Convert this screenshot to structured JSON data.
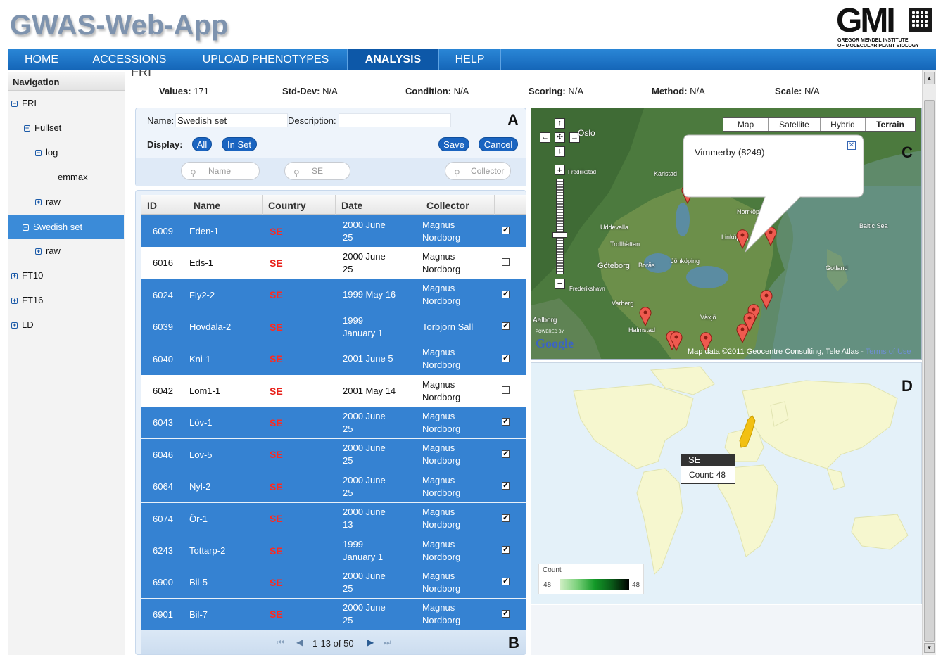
{
  "app": {
    "title": "GWAS-Web-App",
    "logo_text": "GMI",
    "logo_line1": "GREGOR MENDEL INSTITUTE",
    "logo_line2": "OF MOLECULAR PLANT BIOLOGY"
  },
  "nav": [
    "HOME",
    "ACCESSIONS",
    "UPLOAD PHENOTYPES",
    "ANALYSIS",
    "HELP"
  ],
  "sidebar": {
    "heading": "Navigation",
    "items": [
      "FRI",
      "Fullset",
      "log",
      "emmax",
      "raw",
      "Swedish set",
      "raw",
      "FT10",
      "FT16",
      "LD"
    ]
  },
  "page": {
    "heading": "FRI"
  },
  "stats": {
    "values_label": "Values:",
    "values": "171",
    "std_label": "Std-Dev:",
    "std": "N/A",
    "cond_label": "Condition:",
    "cond": "N/A",
    "scoring_label": "Scoring:",
    "scoring": "N/A",
    "method_label": "Method:",
    "method": "N/A",
    "scale_label": "Scale:",
    "scale": "N/A"
  },
  "setform": {
    "name_label": "Name:",
    "name_value": "Swedish set",
    "desc_label": "Description:",
    "desc_value": "",
    "display_label": "Display:",
    "all": "All",
    "inset": "In Set",
    "save": "Save",
    "cancel": "Cancel",
    "filter_name": "Name",
    "filter_country": "SE",
    "filter_collector": "Collector",
    "letter": "A"
  },
  "table": {
    "columns": [
      "ID",
      "Name",
      "Country",
      "Date",
      "Collector"
    ],
    "rows": [
      {
        "id": "6009",
        "name": "Eden-1",
        "country": "SE",
        "date1": "2000 June",
        "date2": "25",
        "col1": "Magnus",
        "col2": "Nordborg",
        "checked": true
      },
      {
        "id": "6016",
        "name": "Eds-1",
        "country": "SE",
        "date1": "2000 June",
        "date2": "25",
        "col1": "Magnus",
        "col2": "Nordborg",
        "checked": false
      },
      {
        "id": "6024",
        "name": "Fly2-2",
        "country": "SE",
        "date1": "1999 May 16",
        "date2": "",
        "col1": "Magnus",
        "col2": "Nordborg",
        "checked": true
      },
      {
        "id": "6039",
        "name": "Hovdala-2",
        "country": "SE",
        "date1": "1999",
        "date2": "January 1",
        "col1": "Torbjorn Sall",
        "col2": "",
        "checked": true
      },
      {
        "id": "6040",
        "name": "Kni-1",
        "country": "SE",
        "date1": "2001 June 5",
        "date2": "",
        "col1": "Magnus",
        "col2": "Nordborg",
        "checked": true
      },
      {
        "id": "6042",
        "name": "Lom1-1",
        "country": "SE",
        "date1": "2001 May 14",
        "date2": "",
        "col1": "Magnus",
        "col2": "Nordborg",
        "checked": false
      },
      {
        "id": "6043",
        "name": "Löv-1",
        "country": "SE",
        "date1": "2000 June",
        "date2": "25",
        "col1": "Magnus",
        "col2": "Nordborg",
        "checked": true
      },
      {
        "id": "6046",
        "name": "Löv-5",
        "country": "SE",
        "date1": "2000 June",
        "date2": "25",
        "col1": "Magnus",
        "col2": "Nordborg",
        "checked": true
      },
      {
        "id": "6064",
        "name": "Nyl-2",
        "country": "SE",
        "date1": "2000 June",
        "date2": "25",
        "col1": "Magnus",
        "col2": "Nordborg",
        "checked": true
      },
      {
        "id": "6074",
        "name": "Ör-1",
        "country": "SE",
        "date1": "2000 June",
        "date2": "13",
        "col1": "Magnus",
        "col2": "Nordborg",
        "checked": true
      },
      {
        "id": "6243",
        "name": "Tottarp-2",
        "country": "SE",
        "date1": "1999",
        "date2": "January 1",
        "col1": "Magnus",
        "col2": "Nordborg",
        "checked": true
      },
      {
        "id": "6900",
        "name": "Bil-5",
        "country": "SE",
        "date1": "2000 June",
        "date2": "25",
        "col1": "Magnus",
        "col2": "Nordborg",
        "checked": true
      },
      {
        "id": "6901",
        "name": "Bil-7",
        "country": "SE",
        "date1": "2000 June",
        "date2": "25",
        "col1": "Magnus",
        "col2": "Nordborg",
        "checked": true
      }
    ],
    "pager": "1-13 of 50",
    "letter": "B"
  },
  "mapC": {
    "types": [
      "Map",
      "Satellite",
      "Hybrid",
      "Terrain"
    ],
    "active": "Terrain",
    "popup": "Vimmerby (8249)",
    "letter": "C",
    "places": [
      "Oslo",
      "Fredrikstad",
      "Karlstad",
      "Norrköping",
      "Baltic Sea",
      "Uddevalla",
      "Trollhättan",
      "Linköping",
      "Göteborg",
      "Borås",
      "Jönköping",
      "Gotland",
      "Frederikshavn",
      "Varberg",
      "Aalborg",
      "Växjö",
      "Halmstad"
    ],
    "powered": "POWERED BY",
    "google": "Google",
    "attribution": "Map data ©2011 Geocentre Consulting, Tele Atlas - ",
    "terms": "Terms of Use"
  },
  "mapD": {
    "tooltip_country": "SE",
    "tooltip_count": "Count: 48",
    "legend_title": "Count",
    "legend_min": "48",
    "legend_max": "48",
    "letter": "D"
  },
  "colors": {
    "accent": "#1d6fc4",
    "selected_row": "#3582d2",
    "country": "#e8221b"
  }
}
